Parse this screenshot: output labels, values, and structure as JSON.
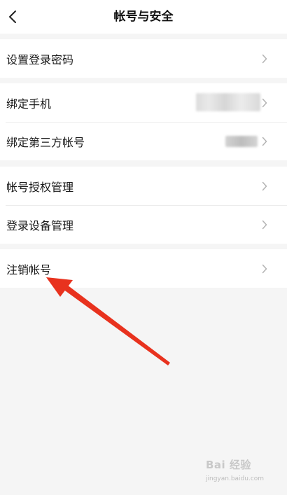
{
  "header": {
    "title": "帐号与安全",
    "back_icon": "chevron-left-icon"
  },
  "groups": [
    {
      "items": [
        {
          "label": "设置登录密码",
          "icon": "chevron-right-icon"
        }
      ]
    },
    {
      "items": [
        {
          "label": "绑定手机",
          "icon": "chevron-right-icon",
          "value": "obscured"
        },
        {
          "label": "绑定第三方帐号",
          "icon": "chevron-right-icon",
          "value": "obscured"
        }
      ]
    },
    {
      "items": [
        {
          "label": "帐号授权管理",
          "icon": "chevron-right-icon"
        },
        {
          "label": "登录设备管理",
          "icon": "chevron-right-icon"
        }
      ]
    },
    {
      "items": [
        {
          "label": "注销帐号",
          "icon": "chevron-right-icon"
        }
      ]
    }
  ],
  "annotation": {
    "color": "#e8321e",
    "points_to": "注销帐号"
  },
  "watermark": {
    "main": "Bai 经验",
    "sub": "jingyan.baidu.com"
  },
  "colors": {
    "background": "#f5f5f5",
    "surface": "#ffffff",
    "text": "#1a1a1a",
    "chevron": "#b3b3b3",
    "arrow": "#e8321e"
  }
}
